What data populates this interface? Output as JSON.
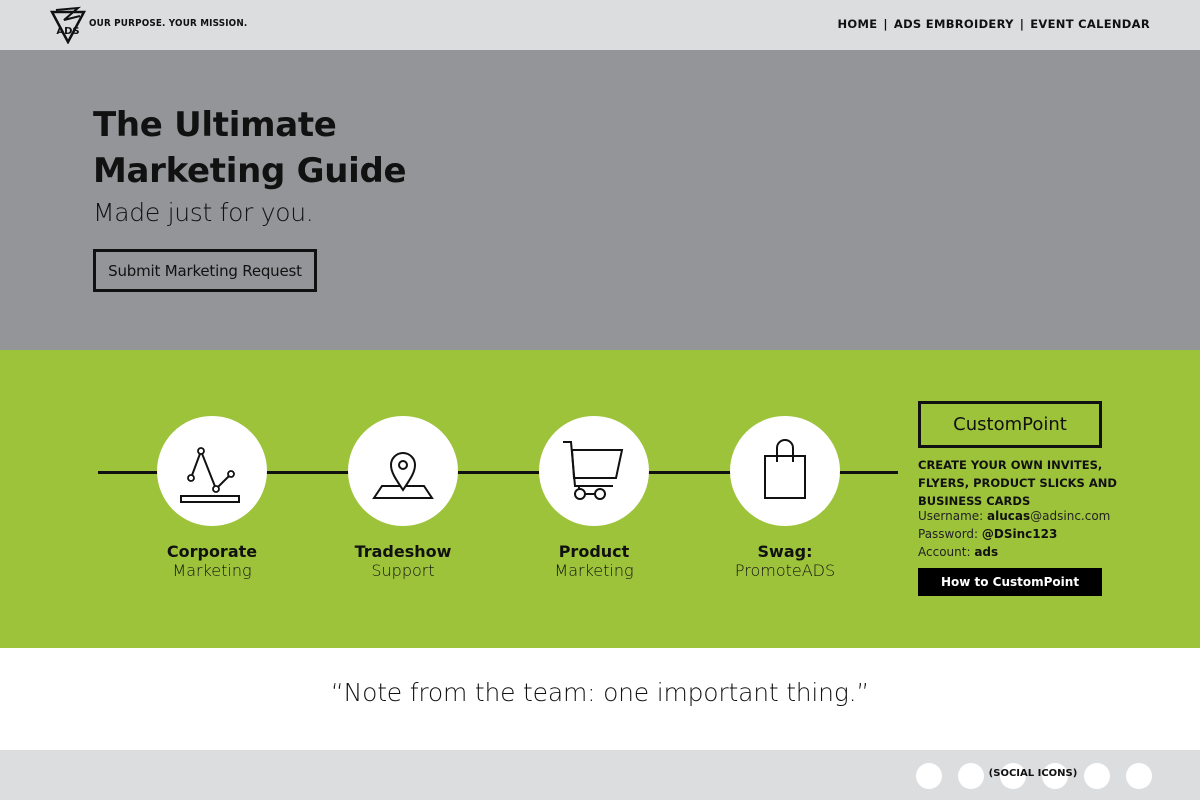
{
  "header": {
    "tagline": "OUR PURPOSE. YOUR MISSION.",
    "logo_text": "ADS",
    "nav": [
      {
        "label": "HOME"
      },
      {
        "label": "ADS EMBROIDERY"
      },
      {
        "label": "EVENT CALENDAR"
      }
    ],
    "nav_separator": "|"
  },
  "hero": {
    "title": "The Ultimate Marketing Guide",
    "subtitle": "Made just for you.",
    "button_label": "Submit Marketing Request",
    "background": "#939598"
  },
  "services": {
    "background": "#9dc33b",
    "items": [
      {
        "title": "Corporate",
        "subtitle": "Marketing",
        "icon": "line-chart-icon"
      },
      {
        "title": "Tradeshow",
        "subtitle": "Support",
        "icon": "map-pin-icon"
      },
      {
        "title": "Product",
        "subtitle": "Marketing",
        "icon": "shopping-cart-icon"
      },
      {
        "title": "Swag:",
        "subtitle": "PromoteADS",
        "icon": "shopping-bag-icon"
      }
    ]
  },
  "custompoint": {
    "title": "CustomPoint",
    "heading": "CREATE YOUR OWN INVITES, FLYERS, PRODUCT SLICKS AND BUSINESS CARDS",
    "username_label": "Username:",
    "username_value_bold": "alucas",
    "username_value_rest": "@adsinc.com",
    "password_label": "Password:",
    "password_value": "@DSinc123",
    "account_label": "Account:",
    "account_value": "ads",
    "button_label": "How to CustomPoint"
  },
  "quote": {
    "text": "“Note from the team: one important thing.”"
  },
  "footer": {
    "social_label": "(SOCIAL ICONS)",
    "social_icon_count": 6
  }
}
